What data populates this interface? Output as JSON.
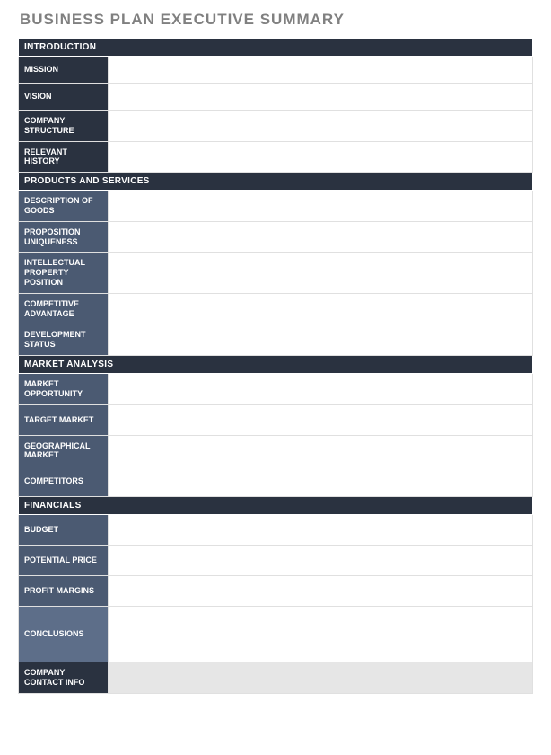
{
  "title": "BUSINESS PLAN EXECUTIVE SUMMARY",
  "sections": {
    "introduction": {
      "header": "INTRODUCTION",
      "rows": {
        "mission": {
          "label": "MISSION",
          "value": ""
        },
        "vision": {
          "label": "VISION",
          "value": ""
        },
        "company_structure": {
          "label": "COMPANY STRUCTURE",
          "value": ""
        },
        "relevant_history": {
          "label": "RELEVANT HISTORY",
          "value": ""
        }
      }
    },
    "products_services": {
      "header": "PRODUCTS AND SERVICES",
      "rows": {
        "description_of_goods": {
          "label": "DESCRIPTION OF GOODS",
          "value": ""
        },
        "proposition_uniqueness": {
          "label": "PROPOSITION UNIQUENESS",
          "value": ""
        },
        "ip_position": {
          "label": "INTELLECTUAL PROPERTY POSITION",
          "value": ""
        },
        "competitive_advantage": {
          "label": "COMPETITIVE ADVANTAGE",
          "value": ""
        },
        "development_status": {
          "label": "DEVELOPMENT STATUS",
          "value": ""
        }
      }
    },
    "market_analysis": {
      "header": "MARKET ANALYSIS",
      "rows": {
        "market_opportunity": {
          "label": "MARKET OPPORTUNITY",
          "value": ""
        },
        "target_market": {
          "label": "TARGET MARKET",
          "value": ""
        },
        "geographical_market": {
          "label": "GEOGRAPHICAL MARKET",
          "value": ""
        },
        "competitors": {
          "label": "COMPETITORS",
          "value": ""
        }
      }
    },
    "financials": {
      "header": "FINANCIALS",
      "rows": {
        "budget": {
          "label": "BUDGET",
          "value": ""
        },
        "potential_price": {
          "label": "POTENTIAL PRICE",
          "value": ""
        },
        "profit_margins": {
          "label": "PROFIT MARGINS",
          "value": ""
        },
        "conclusions": {
          "label": "CONCLUSIONS",
          "value": ""
        }
      }
    },
    "contact": {
      "rows": {
        "company_contact_info": {
          "label": "COMPANY CONTACT INFO",
          "value": ""
        }
      }
    }
  }
}
